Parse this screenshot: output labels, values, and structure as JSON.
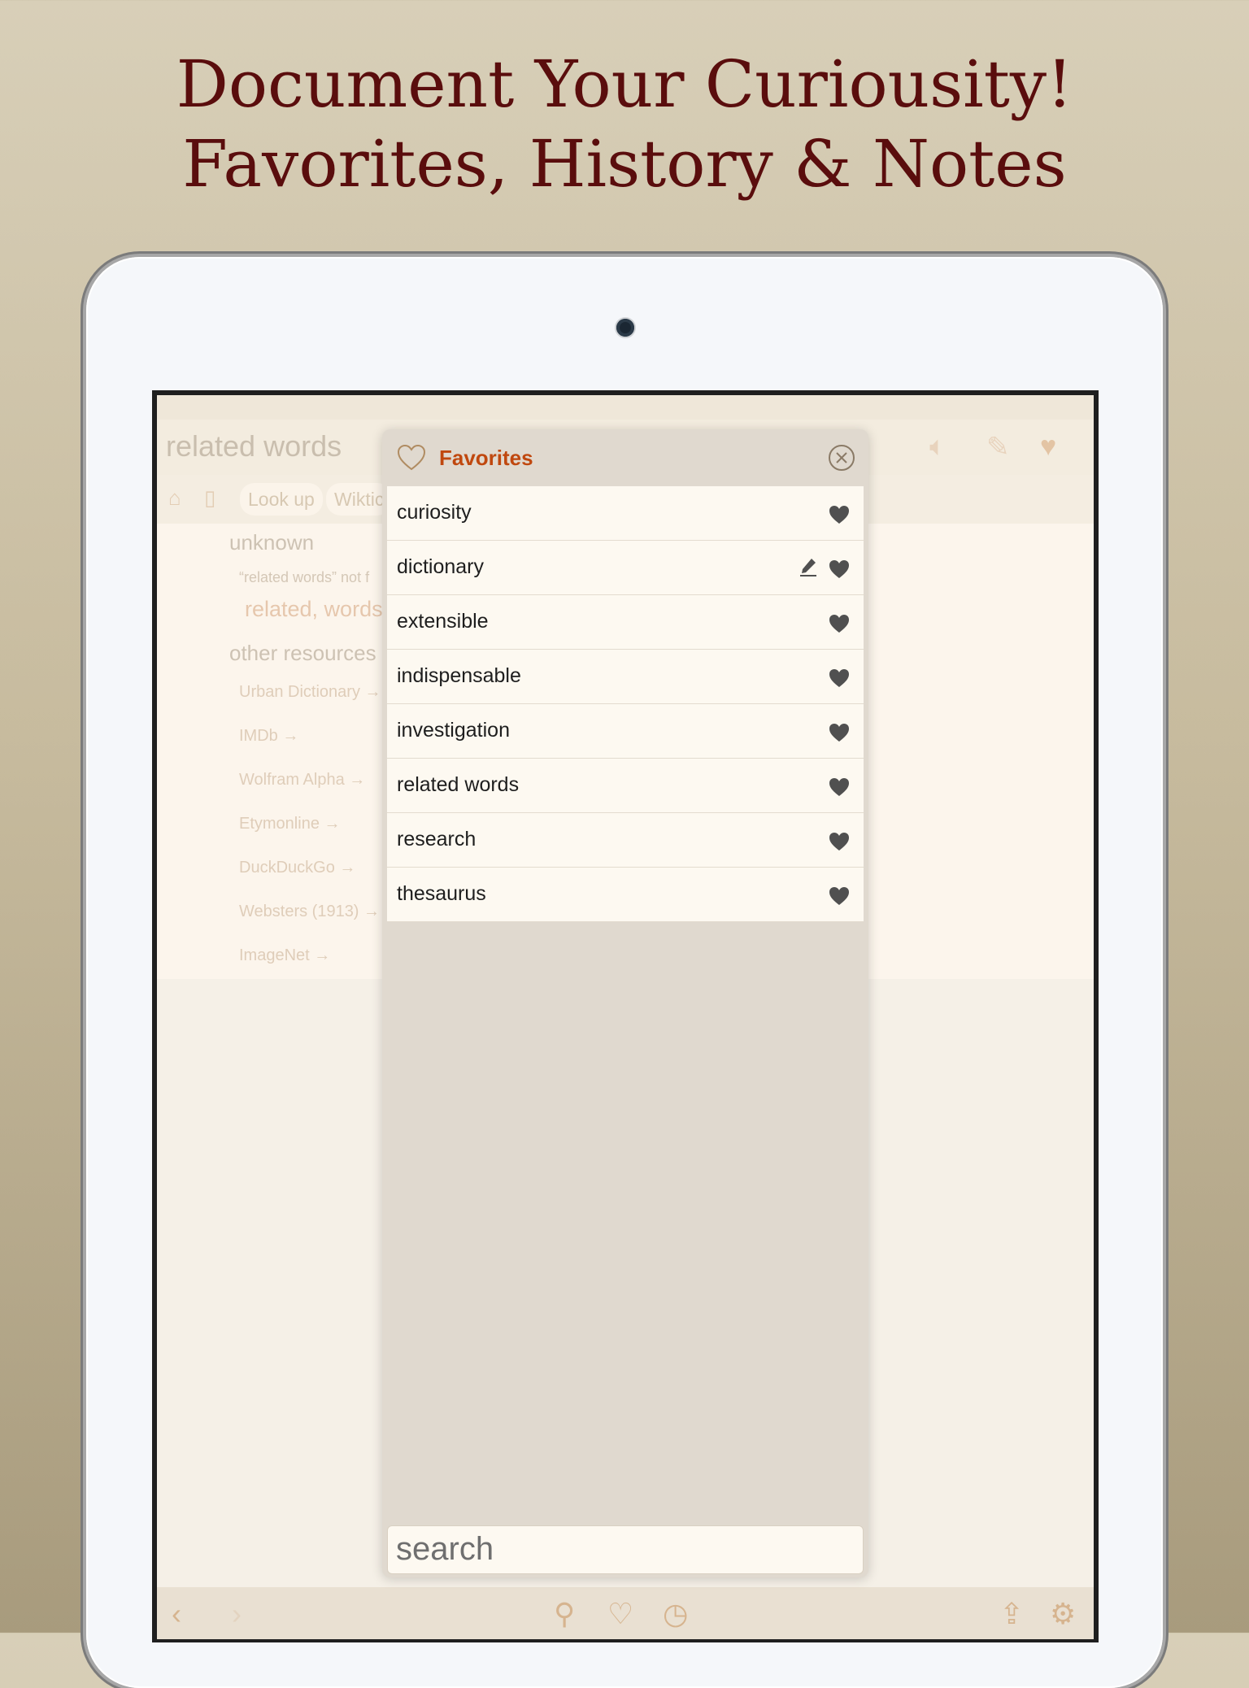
{
  "headline": {
    "line1": "Document Your Curiousity!",
    "line2": "Favorites, History & Notes"
  },
  "background_page": {
    "title": "related words",
    "tabs": [
      "Look up",
      "Wiktic"
    ],
    "section_unknown": "unknown",
    "not_found_text": "“related words” not f",
    "split_words": "related, words",
    "section_other": "other resources",
    "links": [
      "Urban Dictionary →",
      "IMDb →",
      "Wolfram Alpha →",
      "Etymonline →",
      "DuckDuckGo →",
      "Websters (1913) →",
      "ImageNet →"
    ]
  },
  "favorites": {
    "title": "Favorites",
    "items": [
      {
        "label": "curiosity",
        "has_note": false
      },
      {
        "label": "dictionary",
        "has_note": true
      },
      {
        "label": "extensible",
        "has_note": false
      },
      {
        "label": "indispensable",
        "has_note": false
      },
      {
        "label": "investigation",
        "has_note": false
      },
      {
        "label": "related words",
        "has_note": false
      },
      {
        "label": "research",
        "has_note": false
      },
      {
        "label": "thesaurus",
        "has_note": false
      }
    ],
    "search_placeholder": "search"
  },
  "colors": {
    "headline": "#5a0d0d",
    "favorites_title": "#c0480f",
    "heart_filled": "#505050"
  },
  "icons": {
    "toolbar": [
      "back-icon",
      "forward-icon",
      "search-icon",
      "favorites-icon",
      "history-icon",
      "share-icon",
      "settings-icon"
    ],
    "header": [
      "speaker-icon",
      "note-icon",
      "heart-icon"
    ]
  }
}
